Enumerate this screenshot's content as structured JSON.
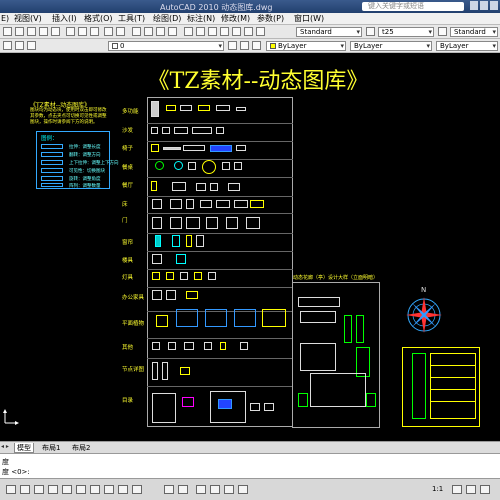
{
  "window": {
    "title": "AutoCAD 2010    动态图库.dwg",
    "search_placeholder": "键入关键字或短语"
  },
  "menu": [
    "E)",
    "视图(V)",
    "插入(I)",
    "格式(O)",
    "工具(T)",
    "绘图(D)",
    "标注(N)",
    "修改(M)",
    "参数(P)",
    "窗口(W)"
  ],
  "toolbar": {
    "text_style": "Standard",
    "dim_style": "t25",
    "table_style": "Standard",
    "layer": "0",
    "color": "ByLayer",
    "linetype": "ByLayer",
    "lineweight": "ByLayer"
  },
  "drawing": {
    "title": "《TZ素材--动态图库》",
    "legend_title": "《TZ素材--动态图库》",
    "legend_desc": "图块均为动态块，使用时双击即可修改其参数，点击夹点可切换可见性或调整图块，操作时请参阅下方的说明。",
    "legend_head": "图例：",
    "legend_items": [
      "拉伸：调整长度",
      "翻转：调整方向",
      "上下拉伸：调整上下方向",
      "可见性：切换图块",
      "旋转：调整角度",
      "阵列：调整数量"
    ],
    "categories": [
      "多功能",
      "沙发",
      "椅子",
      "餐桌",
      "餐厅",
      "床",
      "门",
      "窗帘",
      "楼具",
      "灯具",
      "办公家具",
      "平面植物",
      "其他",
      "节点详图",
      "目录"
    ],
    "sub_title": "动态花廊（亭）设计大样（立面明暗）"
  },
  "tabs": {
    "nav_arrows": "◂ ▸",
    "items": [
      "模型",
      "布局1",
      "布局2"
    ],
    "active": "模型"
  },
  "command": {
    "line1": "度",
    "line2": "度 <0>:"
  },
  "status": {
    "scale": "1:1"
  }
}
